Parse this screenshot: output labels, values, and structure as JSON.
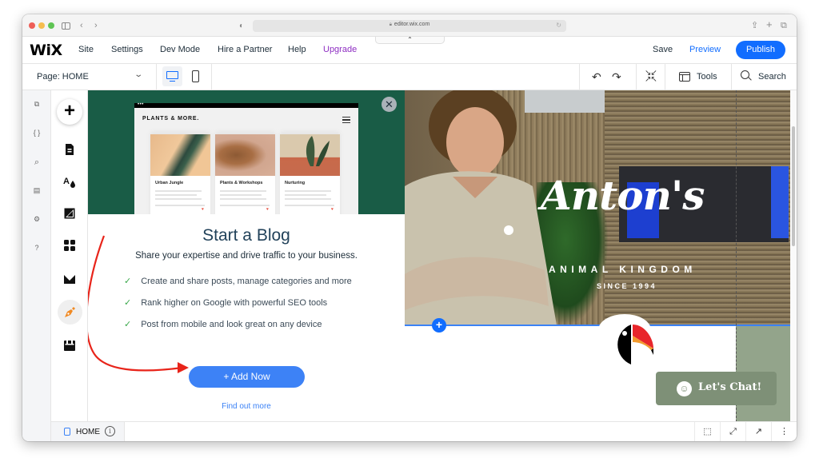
{
  "browser": {
    "url": "editor.wix.com",
    "collapse_glyph": "⌃"
  },
  "topbar": {
    "logo": "WiX",
    "nav": [
      "Site",
      "Settings",
      "Dev Mode",
      "Hire a Partner",
      "Help",
      "Upgrade"
    ],
    "save_label": "Save",
    "preview_label": "Preview",
    "publish_label": "Publish"
  },
  "toolbar": {
    "page_label": "Page: HOME",
    "tools_label": "Tools",
    "search_label": "Search",
    "undo_glyph": "↶",
    "redo_glyph": "↷"
  },
  "dev_sidebar": {
    "items": [
      {
        "icon": "page-code-icon",
        "glyph": "⧉"
      },
      {
        "icon": "braces-icon",
        "glyph": "{ }"
      },
      {
        "icon": "search-icon",
        "glyph": "⌕"
      },
      {
        "icon": "database-icon",
        "glyph": "▤"
      },
      {
        "icon": "wrench-icon",
        "glyph": "⚙"
      },
      {
        "icon": "help-icon",
        "glyph": "?"
      }
    ]
  },
  "add_sidebar": {
    "items": [
      "add-icon",
      "pages-icon",
      "design-icon",
      "background-icon",
      "apps-icon",
      "media-icon",
      "blog-icon",
      "business-icon"
    ],
    "active": "blog-icon",
    "accent": "#f08a24"
  },
  "blog_panel": {
    "close_glyph": "✕",
    "mock": {
      "title": "PLANTS & MORE.",
      "cards": [
        "Urban Jungle",
        "Plants & Workshops",
        "Nurturing"
      ]
    },
    "title": "Start a Blog",
    "subtitle": "Share your expertise and drive traffic to your business.",
    "features": [
      "Create and share posts, manage categories and more",
      "Rank higher on Google with powerful SEO tools",
      "Post from mobile and look great on any device"
    ],
    "check_glyph": "✓",
    "add_now_label": "+ Add Now",
    "find_more_label": "Find out more",
    "hero_color": "#195c46"
  },
  "canvas": {
    "hero_title": "Anton's",
    "hero_subtitle": "ANIMAL KINGDOM",
    "hero_since": "SINCE 1994",
    "add_section_glyph": "+",
    "chat_label": "Let's Chat!",
    "chat_face": "☺"
  },
  "bottombar": {
    "page_label": "HOME",
    "info_glyph": "i",
    "tools": [
      {
        "name": "select-icon",
        "glyph": "⬚"
      },
      {
        "name": "expand-icon",
        "glyph": "⤢"
      },
      {
        "name": "open-external-icon",
        "glyph": "↗"
      },
      {
        "name": "more-icon",
        "glyph": "⋮"
      }
    ]
  }
}
